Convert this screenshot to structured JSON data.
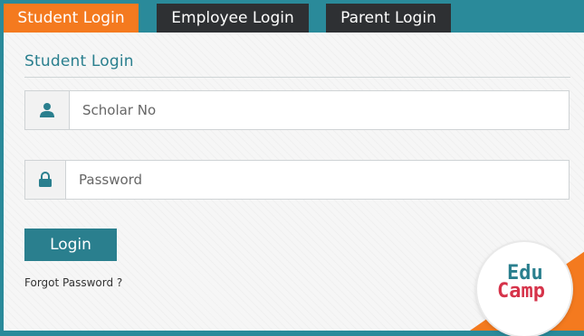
{
  "tabs": [
    {
      "label": "Student Login",
      "active": true
    },
    {
      "label": "Employee Login",
      "active": false
    },
    {
      "label": "Parent Login",
      "active": false
    }
  ],
  "panel": {
    "title": "Student Login",
    "username": {
      "placeholder": "Scholar No",
      "icon": "user-icon",
      "value": ""
    },
    "password": {
      "placeholder": "Password",
      "icon": "lock-icon",
      "value": ""
    },
    "login_label": "Login",
    "forgot_label": "Forgot Password ?"
  },
  "logo": {
    "line1": "Edu",
    "line2": "Camp"
  },
  "colors": {
    "accent_orange": "#f47a1f",
    "teal": "#2a7f8e",
    "dark_tab": "#2e3033",
    "logo_red": "#d6334a"
  }
}
